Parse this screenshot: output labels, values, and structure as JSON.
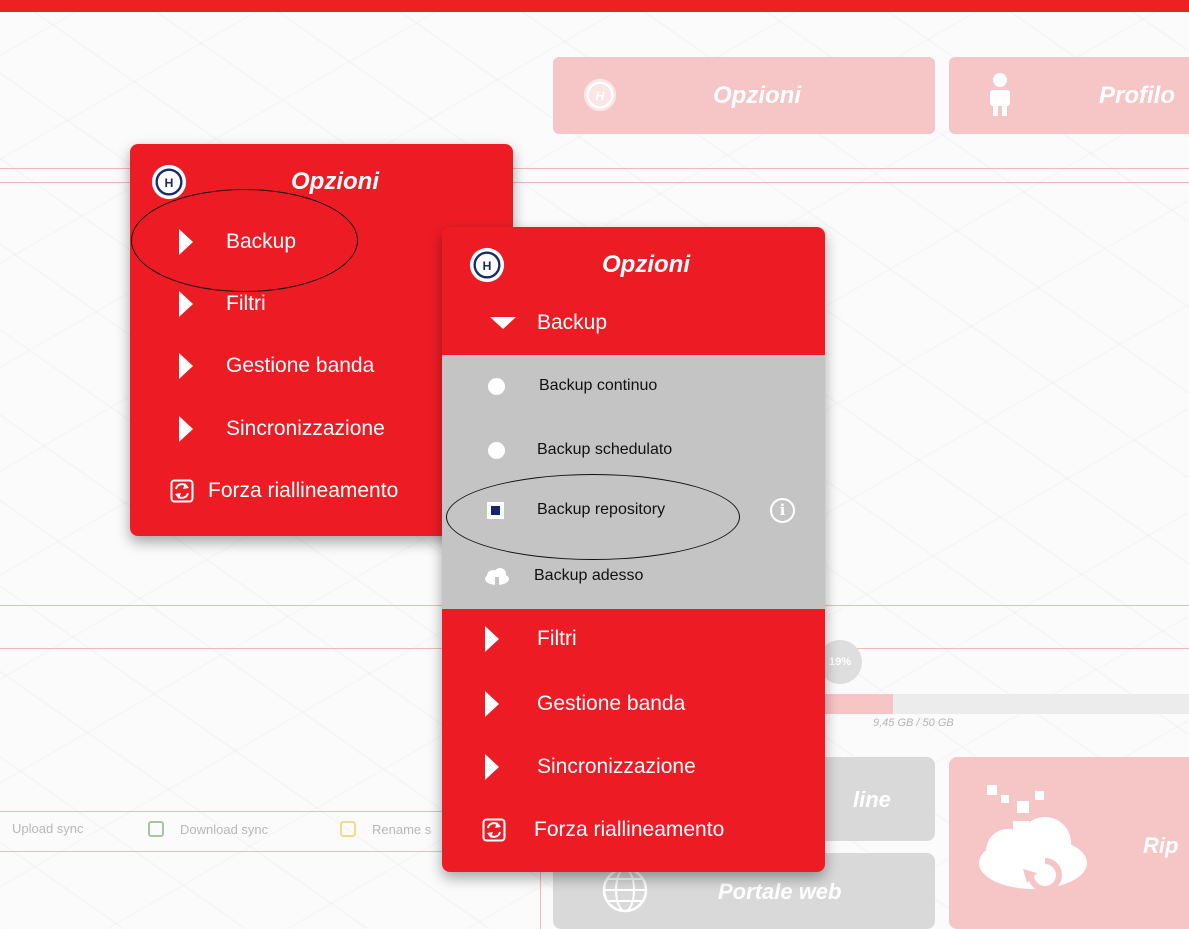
{
  "top_buttons": [
    {
      "label": "Opzioni",
      "icon": "options-logo-icon"
    },
    {
      "label": "Profilo",
      "icon": "user-icon"
    }
  ],
  "background": {
    "storage_usage": "9,45 GB / 50 GB",
    "storage_percent": "19%",
    "storage_fraction": 0.19,
    "legend": [
      "Upload sync",
      "Download sync",
      "Rename s"
    ],
    "tiles": [
      "line",
      "Portale web",
      "Rip"
    ]
  },
  "menu1": {
    "title": "Opzioni",
    "items": [
      {
        "label": "Backup"
      },
      {
        "label": "Filtri"
      },
      {
        "label": "Gestione banda"
      },
      {
        "label": "Sincronizzazione"
      },
      {
        "label": "Forza riallineamento"
      }
    ]
  },
  "menu2": {
    "title": "Opzioni",
    "expanded": {
      "label": "Backup"
    },
    "sub_items": [
      {
        "label": "Backup continuo",
        "type": "radio",
        "checked": false
      },
      {
        "label": "Backup schedulato",
        "type": "radio",
        "checked": false
      },
      {
        "label": "Backup repository",
        "type": "checkbox",
        "checked": true
      },
      {
        "label": "Backup adesso",
        "type": "action"
      }
    ],
    "items": [
      {
        "label": "Filtri"
      },
      {
        "label": "Gestione banda"
      },
      {
        "label": "Sincronizzazione"
      },
      {
        "label": "Forza riallineamento"
      }
    ]
  },
  "colors": {
    "brand_red": "#ed1c24",
    "submenu_gray": "#c4c4c4",
    "check_blue": "#14246e"
  }
}
